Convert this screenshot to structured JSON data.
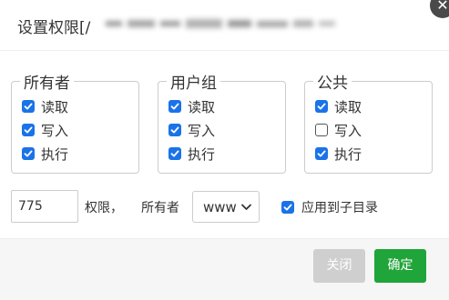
{
  "dialog": {
    "title": "设置权限[/",
    "title_path_redacted": "www/wwwroot/example.com/index.php"
  },
  "groups": [
    {
      "name": "所有者",
      "perms": [
        {
          "label": "读取",
          "checked": true
        },
        {
          "label": "写入",
          "checked": true
        },
        {
          "label": "执行",
          "checked": true
        }
      ]
    },
    {
      "name": "用户组",
      "perms": [
        {
          "label": "读取",
          "checked": true
        },
        {
          "label": "写入",
          "checked": true
        },
        {
          "label": "执行",
          "checked": true
        }
      ]
    },
    {
      "name": "公共",
      "perms": [
        {
          "label": "读取",
          "checked": true
        },
        {
          "label": "写入",
          "checked": false
        },
        {
          "label": "执行",
          "checked": true
        }
      ]
    }
  ],
  "permission_value": "775",
  "permission_label": "权限，",
  "owner_label": "所有者",
  "owner_selected": "www",
  "apply_subdirs": {
    "label": "应用到子目录",
    "checked": true
  },
  "footer": {
    "close_label": "关闭",
    "confirm_label": "确定"
  },
  "colors": {
    "accent": "#1a73e8",
    "confirm": "#20a53a",
    "disabled": "#cfcfcf"
  },
  "icons": {
    "close": "close-icon",
    "check": "check-icon",
    "chevron": "chevron-down-icon"
  }
}
